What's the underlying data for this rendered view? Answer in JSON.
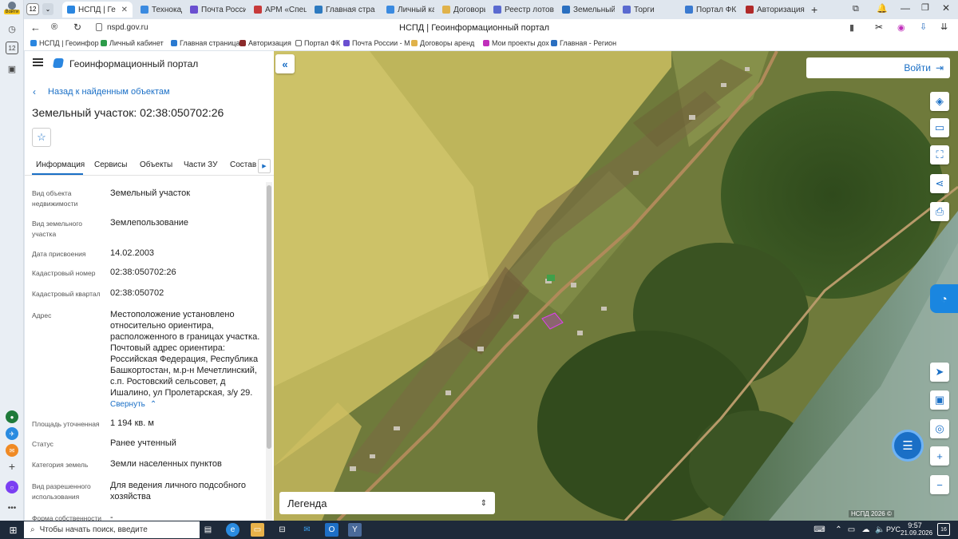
{
  "browser": {
    "tab_count": "12",
    "profile_label": "Войти",
    "tabs": [
      {
        "title": "НСПД | Ге",
        "active": true
      },
      {
        "title": "Технокад ОА"
      },
      {
        "title": "Почта Росси"
      },
      {
        "title": "АРМ «Специ"
      },
      {
        "title": "Главная стра"
      },
      {
        "title": "Личный каби"
      },
      {
        "title": "Договоры ар"
      },
      {
        "title": "Реестр лотов"
      },
      {
        "title": "Земельный у"
      },
      {
        "title": "Торги"
      },
      {
        "title": "Портал ФК"
      },
      {
        "title": "Авторизация"
      }
    ],
    "url": "nspd.gov.ru",
    "page_title": "НСПД | Геоинформационный портал",
    "bookmarks": [
      "НСПД | Геоинфор",
      "Личный кабинет",
      "Главная страница",
      "Авторизация",
      "Портал ФК",
      "Почта России - М",
      "Договоры аренд",
      "Мои проекты дох",
      "Главная - Регион"
    ]
  },
  "portal": {
    "name": "Геоинформационный портал",
    "back_link": "Назад к найденным объектам",
    "object_title": "Земельный участок: 02:38:050702:26",
    "tabs": [
      "Информация",
      "Сервисы",
      "Объекты",
      "Части ЗУ",
      "Состав"
    ],
    "fields": [
      {
        "label": "Вид объекта недвижимости",
        "value": "Земельный участок"
      },
      {
        "label": "Вид земельного участка",
        "value": "Землепользование"
      },
      {
        "label": "Дата присвоения",
        "value": "14.02.2003"
      },
      {
        "label": "Кадастровый номер",
        "value": "02:38:050702:26"
      },
      {
        "label": "Кадастровый квартал",
        "value": "02:38:050702"
      },
      {
        "label": "Адрес",
        "value": "Местоположение установлено относительно ориентира, расположенного в границах участка. Почтовый адрес ориентира: Российская Федерация, Республика Башкортостан, м.р-н Мечетлинский, с.п. Ростовский сельсовет, д Ишалино, ул Пролетарская, з/у 29."
      },
      {
        "label": "Площадь уточненная",
        "value": "1 194 кв. м"
      },
      {
        "label": "Статус",
        "value": "Ранее учтенный"
      },
      {
        "label": "Категория земель",
        "value": "Земли населенных пунктов"
      },
      {
        "label": "Вид разрешенного использования",
        "value": "Для ведения личного подсобного хозяйства"
      },
      {
        "label": "Форма собственности",
        "value": "-"
      }
    ],
    "collapse_label": "Свернуть"
  },
  "map": {
    "login_label": "Войти",
    "legend_label": "Легенда",
    "attribution": "НСПД 2026 ©"
  },
  "taskbar": {
    "search_placeholder": "Чтобы начать поиск, введите",
    "lang": "РУС",
    "time": "9:57",
    "date": "21.09.2026",
    "notif_count": "16"
  },
  "colors": {
    "accent": "#1a6fc6",
    "map_yellow": "#d6c96a",
    "taskbar": "#1e2a3a"
  }
}
